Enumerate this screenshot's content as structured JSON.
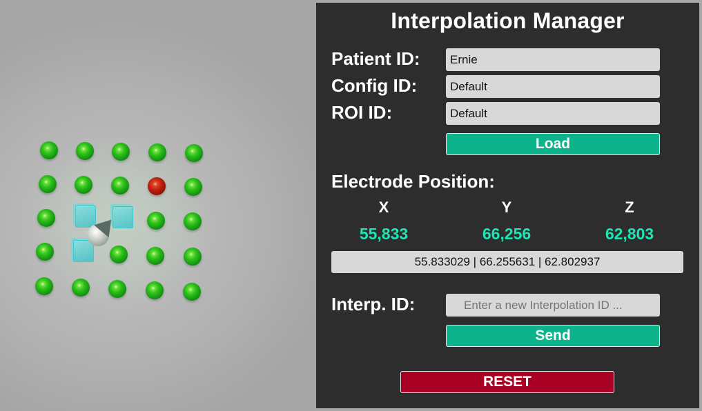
{
  "panel": {
    "title": "Interpolation Manager",
    "patient_label": "Patient ID:",
    "patient_value": "Ernie",
    "config_label": "Config ID:",
    "config_value": "Default",
    "roi_label": "ROI ID:",
    "roi_value": "Default",
    "load_label": "Load",
    "electrode_label": "Electrode Position:",
    "axes": {
      "x": "X",
      "y": "Y",
      "z": "Z"
    },
    "coords": {
      "x": "55,833",
      "y": "66,256",
      "z": "62,803"
    },
    "coord_full": "55.833029 | 66.255631 | 62.802937",
    "interp_label": "Interp. ID:",
    "interp_placeholder": "Enter a new Interpolation ID ...",
    "send_label": "Send",
    "reset_label": "RESET"
  },
  "colors": {
    "panel_bg": "#2d2d2d",
    "accent_green": "#0db38a",
    "coord_teal": "#1de6b4",
    "reset_red": "#a80022",
    "electrode_green": "#2cc01a",
    "electrode_red": "#c02010"
  },
  "viewport": {
    "electrode_grid": {
      "rows": 5,
      "cols": 5,
      "selected_electrode": "row 2, column 4"
    }
  }
}
